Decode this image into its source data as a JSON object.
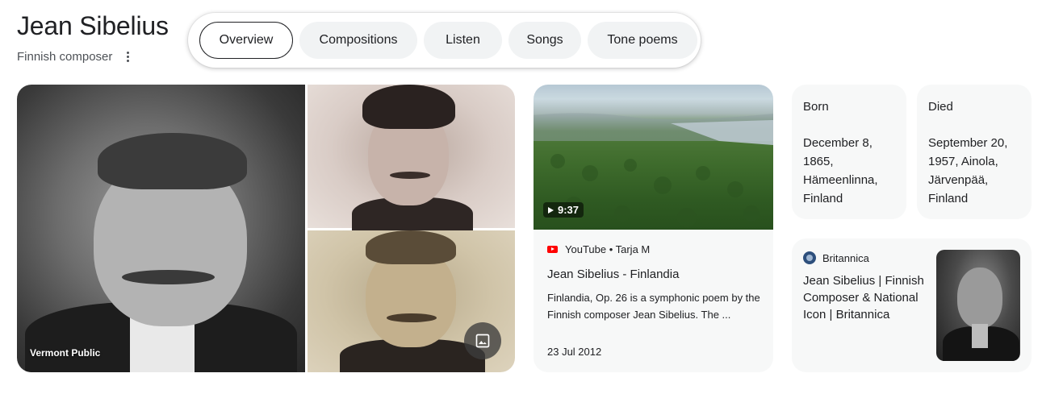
{
  "header": {
    "title": "Jean Sibelius",
    "subtitle": "Finnish composer"
  },
  "tabs": [
    {
      "label": "Overview",
      "active": true
    },
    {
      "label": "Compositions",
      "active": false
    },
    {
      "label": "Listen",
      "active": false
    },
    {
      "label": "Songs",
      "active": false
    },
    {
      "label": "Tone poems",
      "active": false
    }
  ],
  "images": {
    "main_caption": "Vermont Public",
    "more_images_icon": "image-icon"
  },
  "video": {
    "duration": "9:37",
    "source": "YouTube • Tarja M",
    "title": "Jean Sibelius - Finlandia",
    "description": "Finlandia, Op. 26 is a symphonic poem by the Finnish composer Jean Sibelius. The ...",
    "date": "23 Jul 2012"
  },
  "facts": {
    "born": {
      "label": "Born",
      "value": "December 8, 1865, Hämeenlinna, Finland"
    },
    "died": {
      "label": "Died",
      "value": "September 20, 1957, Ainola, Järvenpää, Finland"
    }
  },
  "britannica": {
    "source": "Britannica",
    "title": "Jean Sibelius | Finnish Composer & National Icon | Britannica"
  },
  "colors": {
    "card_bg": "#f7f8f8",
    "chip_bg": "#f1f3f4",
    "youtube_red": "#ff0000"
  }
}
